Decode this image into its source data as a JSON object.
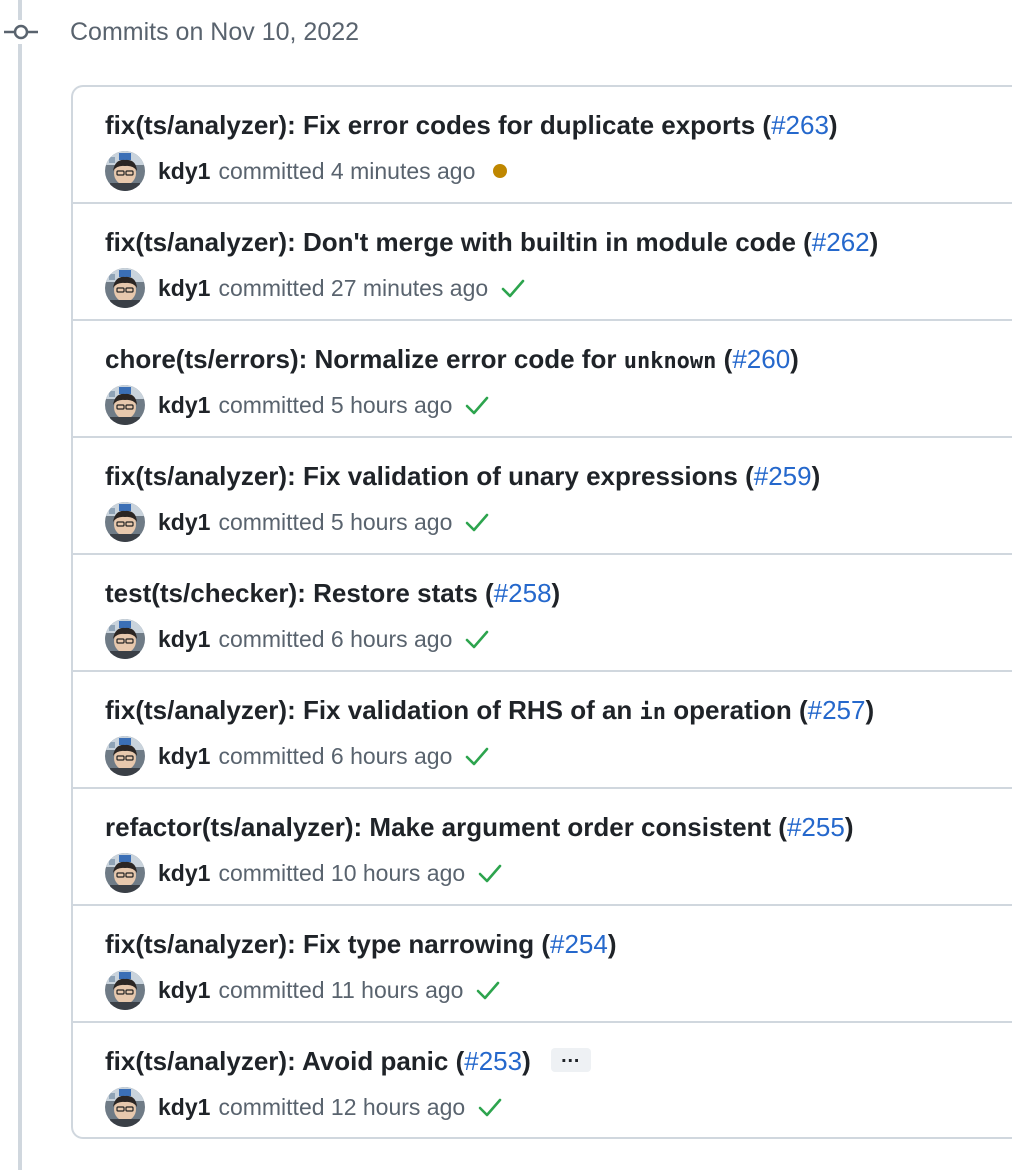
{
  "group": {
    "header": "Commits on Nov 10, 2022"
  },
  "colors": {
    "link": "#2568cc",
    "success": "#2da44e",
    "pending": "#bf8700",
    "border": "#d0d7de",
    "muted": "#59636e"
  },
  "commits": [
    {
      "prefix": "fix(ts/analyzer): Fix error codes for duplicate exports",
      "code": "",
      "suffix": "",
      "pr": "#263",
      "author": "kdy1",
      "committed": "committed 4 minutes ago",
      "status": "pending"
    },
    {
      "prefix": "fix(ts/analyzer): Don't merge with builtin in module code",
      "code": "",
      "suffix": "",
      "pr": "#262",
      "author": "kdy1",
      "committed": "committed 27 minutes ago",
      "status": "success"
    },
    {
      "prefix": "chore(ts/errors): Normalize error code for",
      "code": "unknown",
      "suffix": "",
      "pr": "#260",
      "author": "kdy1",
      "committed": "committed 5 hours ago",
      "status": "success"
    },
    {
      "prefix": "fix(ts/analyzer): Fix validation of unary expressions",
      "code": "",
      "suffix": "",
      "pr": "#259",
      "author": "kdy1",
      "committed": "committed 5 hours ago",
      "status": "success"
    },
    {
      "prefix": "test(ts/checker): Restore stats",
      "code": "",
      "suffix": "",
      "pr": "#258",
      "author": "kdy1",
      "committed": "committed 6 hours ago",
      "status": "success"
    },
    {
      "prefix": "fix(ts/analyzer): Fix validation of RHS of an",
      "code": "in",
      "suffix": "operation",
      "pr": "#257",
      "author": "kdy1",
      "committed": "committed 6 hours ago",
      "status": "success"
    },
    {
      "prefix": "refactor(ts/analyzer): Make argument order consistent",
      "code": "",
      "suffix": "",
      "pr": "#255",
      "author": "kdy1",
      "committed": "committed 10 hours ago",
      "status": "success"
    },
    {
      "prefix": "fix(ts/analyzer): Fix type narrowing",
      "code": "",
      "suffix": "",
      "pr": "#254",
      "author": "kdy1",
      "committed": "committed 11 hours ago",
      "status": "success"
    },
    {
      "prefix": "fix(ts/analyzer): Avoid panic",
      "code": "",
      "suffix": "",
      "pr": "#253",
      "author": "kdy1",
      "committed": "committed 12 hours ago",
      "status": "success",
      "has_more": true,
      "more_label": "…"
    }
  ]
}
